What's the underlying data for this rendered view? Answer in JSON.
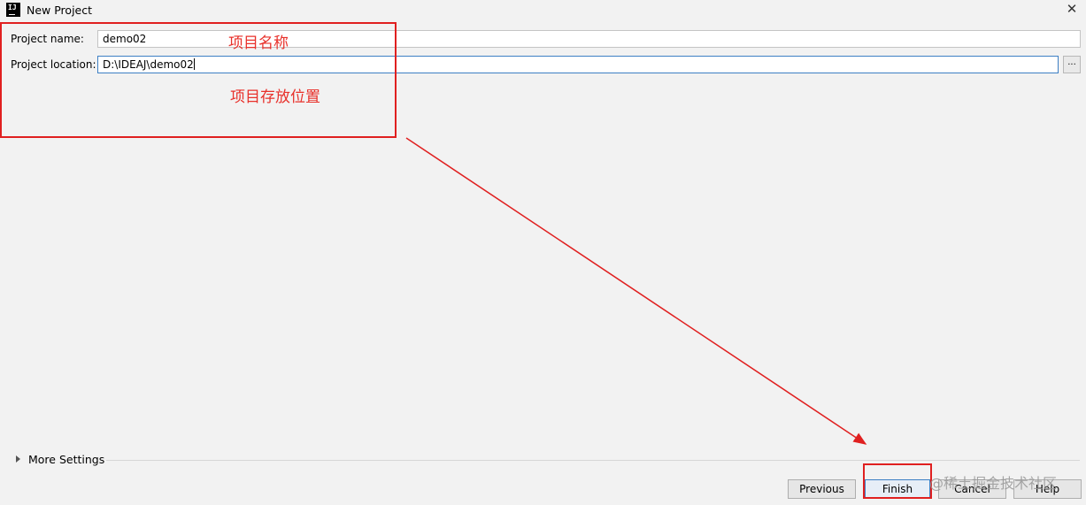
{
  "window": {
    "title": "New Project",
    "app_icon": "IJ",
    "close_glyph": "✕"
  },
  "form": {
    "name_label": "Project name:",
    "name_value": "demo02",
    "location_label": "Project location:",
    "location_value": "D:\\IDEAJ\\demo02",
    "browse_label": "..."
  },
  "annotations": {
    "name_note": "项目名称",
    "location_note": "项目存放位置"
  },
  "more_settings": {
    "label": "More Settings"
  },
  "buttons": {
    "previous": "Previous",
    "finish": "Finish",
    "cancel": "Cancel",
    "help": "Help"
  },
  "watermark": "@稀土掘金技术社区",
  "colors": {
    "annotation": "#e02020",
    "focus": "#3d7fc4",
    "background": "#f2f2f2"
  }
}
